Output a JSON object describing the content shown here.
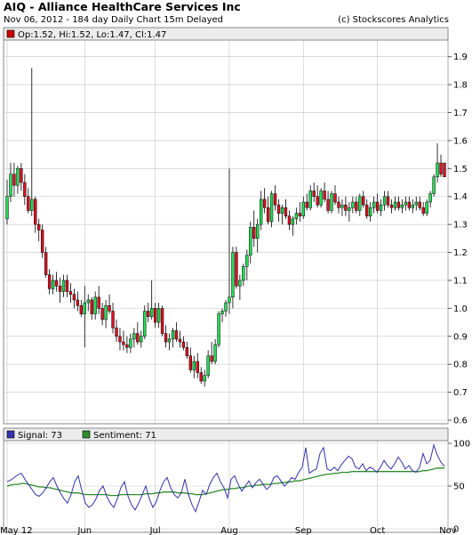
{
  "header": {
    "title": "AIQ - Alliance HealthCare Services Inc",
    "subtitle": "Nov 06, 2012 - 184 day  Daily Chart 15m Delayed",
    "credit": "(c) Stockscores Analytics"
  },
  "price_legend": {
    "ohlc_label": "Op:1.52, Hi:1.52, Lo:1.47, Cl:1.47",
    "swatch_color": "#cc0000"
  },
  "indicator_legend": {
    "signal_label": "Signal: 73",
    "sentiment_label": "Sentiment: 71",
    "signal_color": "#3333aa",
    "sentiment_color": "#2e8b2e"
  },
  "colors": {
    "up": "#22dd55",
    "down": "#dd1122",
    "grid": "#c8c8c8",
    "frame": "#888888"
  },
  "chart_data": [
    {
      "type": "candlestick",
      "title": "AIQ - Alliance HealthCare Services Inc",
      "ylim": [
        0.6,
        1.95
      ],
      "y_ticks": [
        "0.6",
        "0.7",
        "0.8",
        "0.9",
        "1.0",
        "1.1",
        "1.2",
        "1.3",
        "1.4",
        "1.5",
        "1.6",
        "1.7",
        "1.8",
        "1.9"
      ],
      "x_ticks": [
        "May 12",
        "Jun",
        "Jul",
        "Aug",
        "Sep",
        "Oct",
        "Nov"
      ],
      "x_tick_index": [
        0,
        22,
        42,
        63,
        84,
        105,
        125
      ],
      "grid": true,
      "candles": [
        [
          1.32,
          1.46,
          1.3,
          1.4
        ],
        [
          1.4,
          1.52,
          1.38,
          1.48
        ],
        [
          1.48,
          1.52,
          1.4,
          1.44
        ],
        [
          1.44,
          1.51,
          1.41,
          1.5
        ],
        [
          1.5,
          1.52,
          1.42,
          1.45
        ],
        [
          1.45,
          1.48,
          1.37,
          1.4
        ],
        [
          1.4,
          1.43,
          1.34,
          1.35
        ],
        [
          1.35,
          1.86,
          1.33,
          1.39
        ],
        [
          1.39,
          1.4,
          1.27,
          1.3
        ],
        [
          1.3,
          1.32,
          1.24,
          1.28
        ],
        [
          1.28,
          1.3,
          1.18,
          1.2
        ],
        [
          1.2,
          1.22,
          1.11,
          1.12
        ],
        [
          1.12,
          1.14,
          1.05,
          1.07
        ],
        [
          1.07,
          1.12,
          1.05,
          1.1
        ],
        [
          1.1,
          1.13,
          1.06,
          1.08
        ],
        [
          1.08,
          1.11,
          1.02,
          1.06
        ],
        [
          1.06,
          1.12,
          1.04,
          1.1
        ],
        [
          1.1,
          1.12,
          1.04,
          1.06
        ],
        [
          1.06,
          1.09,
          1.02,
          1.05
        ],
        [
          1.05,
          1.07,
          1.0,
          1.03
        ],
        [
          1.03,
          1.06,
          0.99,
          1.01
        ],
        [
          1.01,
          1.03,
          0.97,
          0.98
        ],
        [
          0.98,
          1.08,
          0.86,
          1.02
        ],
        [
          1.02,
          1.05,
          0.99,
          1.03
        ],
        [
          1.03,
          1.04,
          0.96,
          0.98
        ],
        [
          0.98,
          1.06,
          0.96,
          1.04
        ],
        [
          1.04,
          1.08,
          0.98,
          1.0
        ],
        [
          1.0,
          1.02,
          0.94,
          0.96
        ],
        [
          0.96,
          1.03,
          0.93,
          1.01
        ],
        [
          1.01,
          1.05,
          0.98,
          0.99
        ],
        [
          0.99,
          1.02,
          0.91,
          0.93
        ],
        [
          0.93,
          0.96,
          0.88,
          0.9
        ],
        [
          0.9,
          0.93,
          0.85,
          0.88
        ],
        [
          0.88,
          0.92,
          0.85,
          0.87
        ],
        [
          0.87,
          0.9,
          0.84,
          0.86
        ],
        [
          0.86,
          0.91,
          0.84,
          0.89
        ],
        [
          0.89,
          0.93,
          0.86,
          0.91
        ],
        [
          0.91,
          0.95,
          0.87,
          0.88
        ],
        [
          0.88,
          0.92,
          0.86,
          0.9
        ],
        [
          0.9,
          1.01,
          0.89,
          0.99
        ],
        [
          0.99,
          1.02,
          0.95,
          0.97
        ],
        [
          0.97,
          1.1,
          0.96,
          1.0
        ],
        [
          1.0,
          1.02,
          0.93,
          0.95
        ],
        [
          0.95,
          1.02,
          0.93,
          1.0
        ],
        [
          1.0,
          1.01,
          0.9,
          0.91
        ],
        [
          0.91,
          0.94,
          0.86,
          0.88
        ],
        [
          0.88,
          0.91,
          0.85,
          0.89
        ],
        [
          0.89,
          0.93,
          0.86,
          0.92
        ],
        [
          0.92,
          0.95,
          0.88,
          0.89
        ],
        [
          0.89,
          0.92,
          0.86,
          0.88
        ],
        [
          0.88,
          0.9,
          0.85,
          0.86
        ],
        [
          0.86,
          0.88,
          0.82,
          0.83
        ],
        [
          0.83,
          0.86,
          0.77,
          0.78
        ],
        [
          0.78,
          0.83,
          0.75,
          0.81
        ],
        [
          0.81,
          0.84,
          0.75,
          0.77
        ],
        [
          0.77,
          0.79,
          0.73,
          0.74
        ],
        [
          0.74,
          0.78,
          0.72,
          0.76
        ],
        [
          0.76,
          0.85,
          0.75,
          0.83
        ],
        [
          0.83,
          0.88,
          0.8,
          0.81
        ],
        [
          0.81,
          0.89,
          0.8,
          0.87
        ],
        [
          0.87,
          0.99,
          0.86,
          0.98
        ],
        [
          0.98,
          1.0,
          0.95,
          0.99
        ],
        [
          0.99,
          1.03,
          0.97,
          1.02
        ],
        [
          1.02,
          1.5,
          0.98,
          1.04
        ],
        [
          1.04,
          1.22,
          1.0,
          1.2
        ],
        [
          1.2,
          1.22,
          1.07,
          1.08
        ],
        [
          1.08,
          1.12,
          1.03,
          1.1
        ],
        [
          1.1,
          1.16,
          1.08,
          1.15
        ],
        [
          1.15,
          1.21,
          1.1,
          1.19
        ],
        [
          1.19,
          1.31,
          1.16,
          1.29
        ],
        [
          1.29,
          1.35,
          1.22,
          1.25
        ],
        [
          1.25,
          1.32,
          1.2,
          1.3
        ],
        [
          1.3,
          1.42,
          1.28,
          1.39
        ],
        [
          1.39,
          1.43,
          1.34,
          1.36
        ],
        [
          1.36,
          1.4,
          1.3,
          1.31
        ],
        [
          1.31,
          1.42,
          1.29,
          1.41
        ],
        [
          1.41,
          1.44,
          1.35,
          1.37
        ],
        [
          1.37,
          1.39,
          1.31,
          1.34
        ],
        [
          1.34,
          1.37,
          1.3,
          1.36
        ],
        [
          1.36,
          1.39,
          1.32,
          1.33
        ],
        [
          1.33,
          1.35,
          1.28,
          1.3
        ],
        [
          1.3,
          1.33,
          1.26,
          1.32
        ],
        [
          1.32,
          1.36,
          1.3,
          1.34
        ],
        [
          1.34,
          1.38,
          1.31,
          1.33
        ],
        [
          1.33,
          1.4,
          1.32,
          1.38
        ],
        [
          1.38,
          1.41,
          1.35,
          1.36
        ],
        [
          1.36,
          1.44,
          1.35,
          1.42
        ],
        [
          1.42,
          1.45,
          1.38,
          1.4
        ],
        [
          1.4,
          1.44,
          1.36,
          1.37
        ],
        [
          1.37,
          1.43,
          1.36,
          1.42
        ],
        [
          1.42,
          1.45,
          1.38,
          1.39
        ],
        [
          1.39,
          1.42,
          1.34,
          1.35
        ],
        [
          1.35,
          1.42,
          1.34,
          1.41
        ],
        [
          1.41,
          1.44,
          1.37,
          1.38
        ],
        [
          1.38,
          1.4,
          1.34,
          1.36
        ],
        [
          1.36,
          1.39,
          1.33,
          1.37
        ],
        [
          1.37,
          1.4,
          1.33,
          1.35
        ],
        [
          1.35,
          1.38,
          1.31,
          1.36
        ],
        [
          1.36,
          1.4,
          1.34,
          1.38
        ],
        [
          1.38,
          1.4,
          1.34,
          1.35
        ],
        [
          1.35,
          1.41,
          1.33,
          1.4
        ],
        [
          1.4,
          1.42,
          1.36,
          1.37
        ],
        [
          1.37,
          1.39,
          1.32,
          1.33
        ],
        [
          1.33,
          1.38,
          1.31,
          1.36
        ],
        [
          1.36,
          1.4,
          1.34,
          1.38
        ],
        [
          1.38,
          1.41,
          1.34,
          1.35
        ],
        [
          1.35,
          1.39,
          1.33,
          1.37
        ],
        [
          1.37,
          1.42,
          1.35,
          1.4
        ],
        [
          1.4,
          1.42,
          1.36,
          1.37
        ],
        [
          1.37,
          1.39,
          1.34,
          1.36
        ],
        [
          1.36,
          1.4,
          1.35,
          1.38
        ],
        [
          1.38,
          1.4,
          1.35,
          1.36
        ],
        [
          1.36,
          1.39,
          1.34,
          1.37
        ],
        [
          1.37,
          1.4,
          1.35,
          1.38
        ],
        [
          1.38,
          1.4,
          1.35,
          1.36
        ],
        [
          1.36,
          1.39,
          1.34,
          1.37
        ],
        [
          1.37,
          1.4,
          1.35,
          1.38
        ],
        [
          1.38,
          1.4,
          1.35,
          1.36
        ],
        [
          1.36,
          1.38,
          1.33,
          1.34
        ],
        [
          1.34,
          1.39,
          1.33,
          1.38
        ],
        [
          1.38,
          1.42,
          1.36,
          1.41
        ],
        [
          1.41,
          1.48,
          1.4,
          1.47
        ],
        [
          1.47,
          1.59,
          1.45,
          1.52
        ],
        [
          1.52,
          1.55,
          1.47,
          1.48
        ],
        [
          1.52,
          1.52,
          1.47,
          1.47
        ]
      ]
    },
    {
      "type": "line",
      "ylim": [
        0,
        100
      ],
      "y_ticks": [
        "0",
        "50",
        "100"
      ],
      "grid": true,
      "series": [
        {
          "name": "Signal",
          "values": [
            55,
            57,
            60,
            63,
            65,
            58,
            52,
            46,
            40,
            38,
            42,
            48,
            55,
            60,
            50,
            42,
            35,
            30,
            40,
            55,
            62,
            45,
            30,
            25,
            28,
            35,
            45,
            50,
            38,
            30,
            25,
            35,
            48,
            55,
            38,
            28,
            22,
            30,
            40,
            50,
            35,
            25,
            32,
            45,
            55,
            60,
            48,
            40,
            36,
            42,
            58,
            40,
            28,
            20,
            32,
            45,
            40,
            52,
            60,
            65,
            55,
            48,
            36,
            58,
            62,
            52,
            44,
            50,
            56,
            48,
            54,
            58,
            52,
            46,
            50,
            60,
            62,
            56,
            50,
            54,
            60,
            58,
            66,
            72,
            95,
            65,
            68,
            70,
            88,
            95,
            70,
            68,
            72,
            68,
            75,
            80,
            85,
            82,
            72,
            70,
            76,
            68,
            72,
            70,
            66,
            72,
            80,
            74,
            70,
            76,
            84,
            78,
            70,
            74,
            68,
            66,
            72,
            88,
            76,
            80,
            98,
            86,
            78,
            73
          ]
        },
        {
          "name": "Sentiment",
          "values": [
            50,
            51,
            52,
            52,
            53,
            53,
            52,
            51,
            50,
            49,
            49,
            48,
            48,
            47,
            46,
            45,
            44,
            43,
            42,
            42,
            42,
            41,
            40,
            40,
            40,
            40,
            40,
            40,
            40,
            39,
            39,
            39,
            40,
            40,
            40,
            40,
            40,
            40,
            40,
            41,
            41,
            41,
            42,
            42,
            43,
            43,
            43,
            43,
            42,
            42,
            42,
            41,
            41,
            40,
            40,
            40,
            41,
            42,
            43,
            44,
            45,
            46,
            46,
            47,
            47,
            48,
            48,
            49,
            50,
            50,
            51,
            51,
            52,
            52,
            52,
            53,
            53,
            54,
            54,
            55,
            55,
            56,
            56,
            57,
            58,
            59,
            60,
            61,
            62,
            63,
            64,
            64,
            65,
            65,
            66,
            66,
            66,
            67,
            67,
            67,
            67,
            67,
            67,
            67,
            67,
            67,
            67,
            67,
            67,
            67,
            67,
            67,
            67,
            67,
            67,
            67,
            67,
            68,
            68,
            69,
            70,
            71,
            71,
            71
          ]
        }
      ]
    }
  ]
}
